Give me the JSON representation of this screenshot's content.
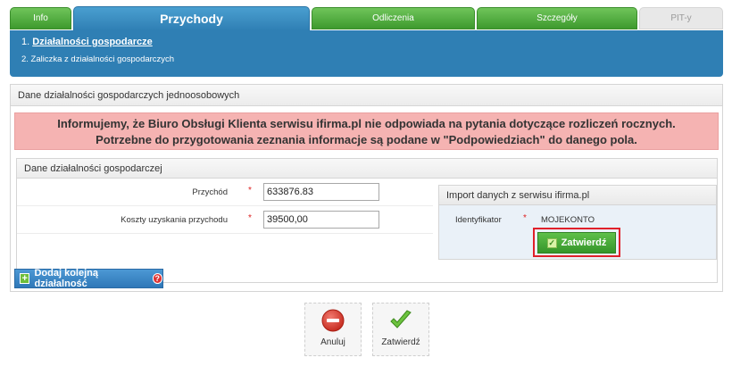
{
  "tabs": [
    {
      "label": "Info",
      "state": "green"
    },
    {
      "label": "Przychody",
      "state": "active"
    },
    {
      "label": "Odliczenia",
      "state": "green"
    },
    {
      "label": "Szczegóły",
      "state": "green"
    },
    {
      "label": "PIT-y",
      "state": "disabled"
    }
  ],
  "steps": {
    "step1": "Działalności gospodarcze",
    "step1_number": "1.",
    "step2": "2. Zaliczka z działalności gospodarczych"
  },
  "panel": {
    "title": "Dane działalności gospodarczych jednoosobowych",
    "alert_line1": "Informujemy, że Biuro Obsługi Klienta serwisu ifirma.pl nie odpowiada na pytania dotyczące rozliczeń rocznych.",
    "alert_line2": "Potrzebne do przygotowania zeznania informacje są podane w \"Podpowiedziach\" do danego pola."
  },
  "business": {
    "title": "Dane działalności gospodarczej",
    "revenue_label": "Przychód",
    "revenue_value": "633876.83",
    "costs_label": "Koszty uzyskania przychodu",
    "costs_value": "39500,00",
    "required_mark": "*"
  },
  "import": {
    "title": "Import danych z serwisu ifirma.pl",
    "id_label": "Identyfikator",
    "id_value": "MOJEKONTO",
    "confirm_label": "Zatwierdź"
  },
  "actions": {
    "add_business": "Dodaj kolejną działalność",
    "cancel": "Anuluj",
    "confirm": "Zatwierdź"
  },
  "colors": {
    "tab_green": "#4aa83a",
    "tab_active_blue": "#2f7fb4",
    "alert_bg": "#f5b3b2",
    "highlight_border": "#e0202a"
  }
}
